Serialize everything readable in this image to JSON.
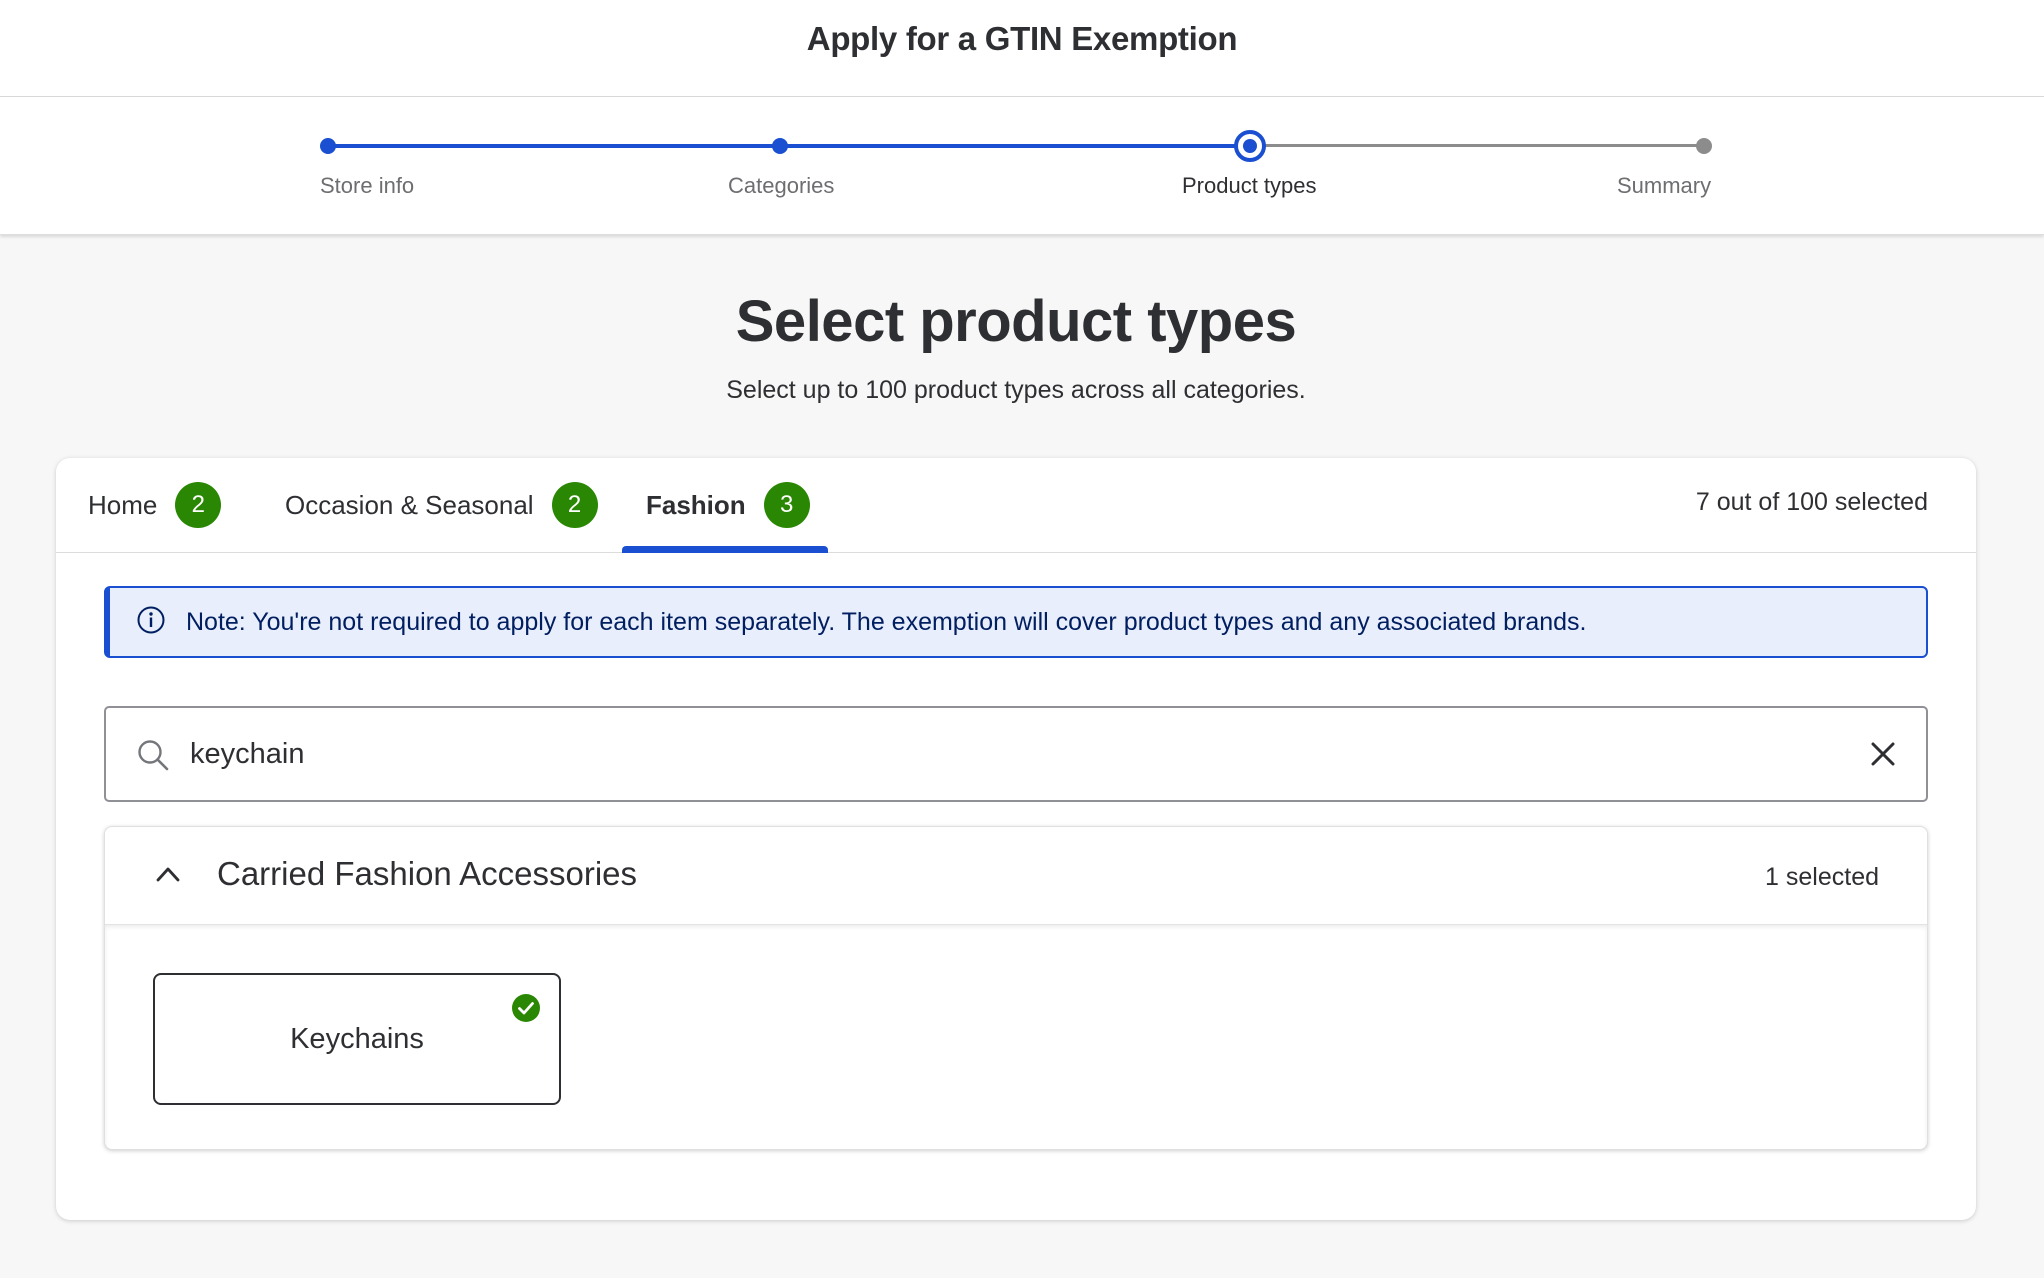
{
  "header": {
    "title": "Apply for a GTIN Exemption"
  },
  "stepper": {
    "steps": [
      {
        "label": "Store info",
        "state": "complete"
      },
      {
        "label": "Categories",
        "state": "complete"
      },
      {
        "label": "Product types",
        "state": "current"
      },
      {
        "label": "Summary",
        "state": "upcoming"
      }
    ]
  },
  "page": {
    "title": "Select product types",
    "subtitle": "Select up to 100 product types across all categories."
  },
  "tabs": [
    {
      "label": "Home",
      "count": "2"
    },
    {
      "label": "Occasion & Seasonal",
      "count": "2"
    },
    {
      "label": "Fashion",
      "count": "3",
      "active": true
    }
  ],
  "selection_summary": "7 out of 100 selected",
  "note": {
    "icon": "info-icon",
    "text": "Note: You're not required to apply for each item separately. The exemption will cover product types and any associated brands."
  },
  "search": {
    "value": "keychain",
    "placeholder": "",
    "icon": "search-icon",
    "clear_icon": "close-icon"
  },
  "accordion": {
    "title": "Carried Fashion Accessories",
    "count": "1 selected",
    "expanded": true,
    "options": [
      {
        "label": "Keychains",
        "selected": true
      }
    ]
  },
  "colors": {
    "primary_blue": "#1a4fd1",
    "badge_green": "#2a8703",
    "note_bg": "#e8eefb",
    "note_text": "#001e60",
    "text": "#2e2f32"
  }
}
